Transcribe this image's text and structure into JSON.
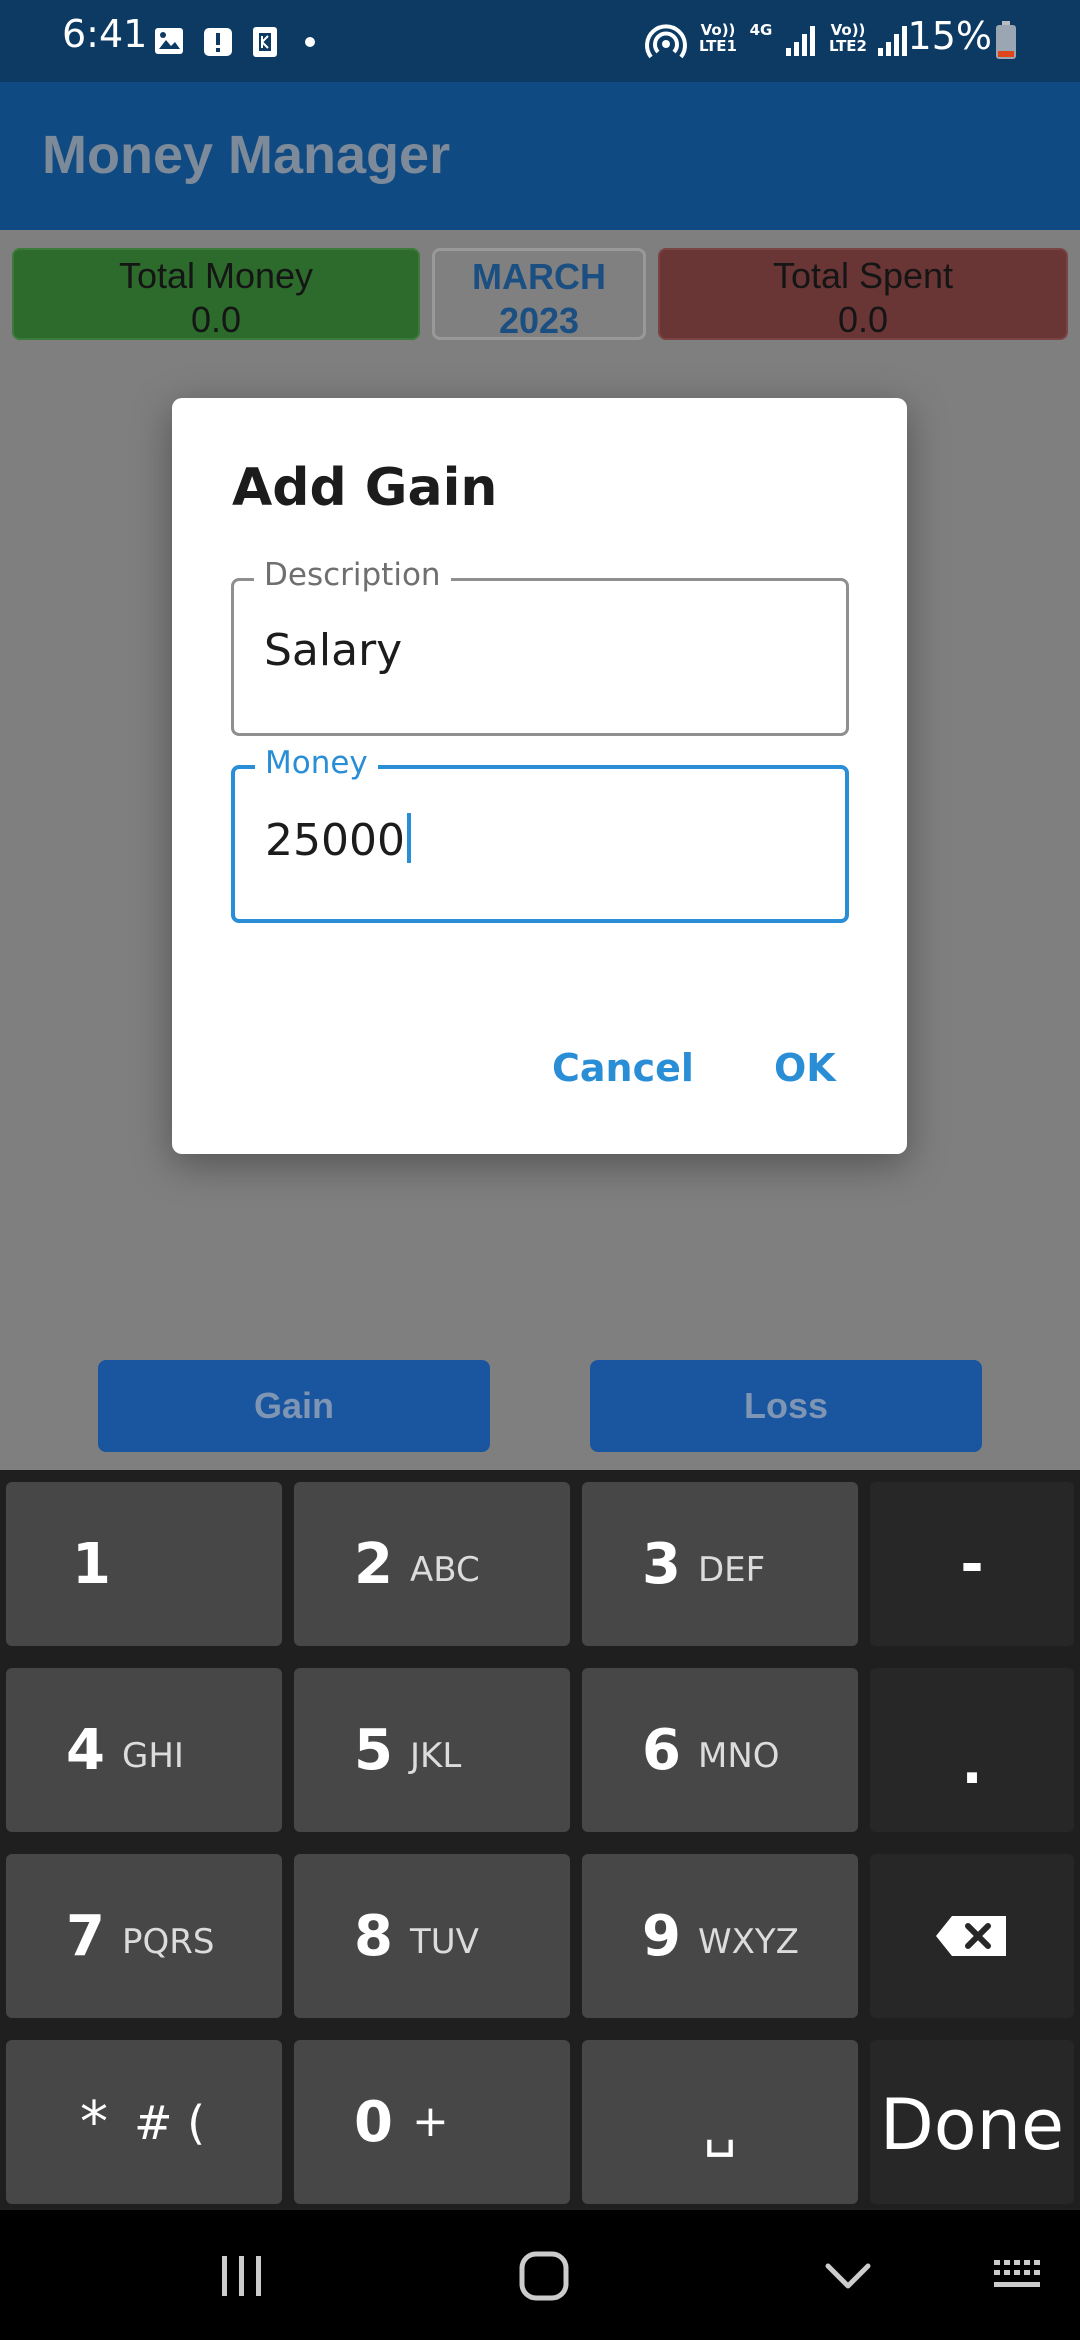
{
  "status_bar": {
    "time": "6:41",
    "battery_percent": "15%",
    "sim1_label_top": "Vo))",
    "sim1_label_bottom": "LTE1",
    "sim2_label_top": "Vo))",
    "sim2_label_bottom": "LTE2",
    "net_type": "4G",
    "icons": [
      "image-icon",
      "alert-icon",
      "k-app-icon",
      "dot-icon",
      "hotspot-icon",
      "signal-icon",
      "battery-icon"
    ]
  },
  "app_bar": {
    "title": "Money Manager"
  },
  "summary": {
    "total_money_label": "Total Money",
    "total_money_value": "0.0",
    "month": "MARCH",
    "year": "2023",
    "total_spent_label": "Total Spent",
    "total_spent_value": "0.0"
  },
  "buttons": {
    "gain": "Gain",
    "loss": "Loss"
  },
  "dialog": {
    "title": "Add Gain",
    "description_label": "Description",
    "description_value": "Salary",
    "money_label": "Money",
    "money_value": "25000",
    "cancel": "Cancel",
    "ok": "OK"
  },
  "keyboard": {
    "keys": [
      {
        "num": "1",
        "letters": ""
      },
      {
        "num": "2",
        "letters": "ABC"
      },
      {
        "num": "3",
        "letters": "DEF"
      },
      {
        "num": "4",
        "letters": "GHI"
      },
      {
        "num": "5",
        "letters": "JKL"
      },
      {
        "num": "6",
        "letters": "MNO"
      },
      {
        "num": "7",
        "letters": "PQRS"
      },
      {
        "num": "8",
        "letters": "TUV"
      },
      {
        "num": "9",
        "letters": "WXYZ"
      },
      {
        "num": "*",
        "letters": "# ("
      },
      {
        "num": "0",
        "letters": "+"
      },
      {
        "num": "",
        "letters": "␣"
      }
    ],
    "minus": "-",
    "dot": ".",
    "done": "Done"
  },
  "colors": {
    "accent": "#2a8ed6",
    "app_bar": "#0f4a82",
    "gain_box": "#2c6b2c",
    "spent_box": "#6a3535"
  }
}
